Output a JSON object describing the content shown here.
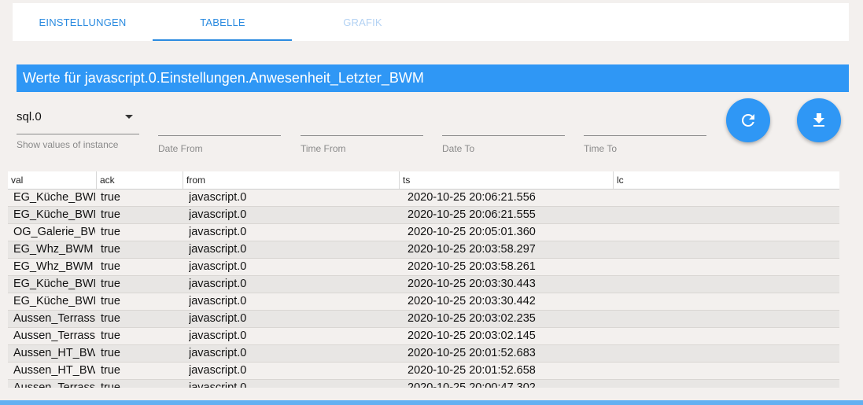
{
  "tabs": [
    {
      "label": "EINSTELLUNGEN"
    },
    {
      "label": "TABELLE"
    },
    {
      "label": "GRAFIK"
    }
  ],
  "title": "Werte für javascript.0.Einstellungen.Anwesenheit_Letzter_BWM",
  "filters": {
    "instance_value": "sql.0",
    "instance_label": "Show values of instance",
    "date_from_label": "Date From",
    "time_from_label": "Time From",
    "date_to_label": "Date To",
    "time_to_label": "Time To"
  },
  "actions": {
    "refresh_icon": "refresh-icon",
    "download_icon": "download-icon",
    "accent": "#2f97f5"
  },
  "table": {
    "columns": [
      "val",
      "ack",
      "from",
      "ts",
      "lc"
    ],
    "rows": [
      {
        "val": "EG_Küche_BWM",
        "ack": "true",
        "from": "javascript.0",
        "ts": "2020-10-25 20:06:21.556"
      },
      {
        "val": "EG_Küche_BWM",
        "ack": "true",
        "from": "javascript.0",
        "ts": "2020-10-25 20:06:21.555"
      },
      {
        "val": "OG_Galerie_BWM",
        "ack": "true",
        "from": "javascript.0",
        "ts": "2020-10-25 20:05:01.360"
      },
      {
        "val": "EG_Whz_BWM",
        "ack": "true",
        "from": "javascript.0",
        "ts": "2020-10-25 20:03:58.297"
      },
      {
        "val": "EG_Whz_BWM",
        "ack": "true",
        "from": "javascript.0",
        "ts": "2020-10-25 20:03:58.261"
      },
      {
        "val": "EG_Küche_BWM",
        "ack": "true",
        "from": "javascript.0",
        "ts": "2020-10-25 20:03:30.443"
      },
      {
        "val": "EG_Küche_BWM",
        "ack": "true",
        "from": "javascript.0",
        "ts": "2020-10-25 20:03:30.442"
      },
      {
        "val": "Aussen_Terrasse",
        "ack": "true",
        "from": "javascript.0",
        "ts": "2020-10-25 20:03:02.235"
      },
      {
        "val": "Aussen_Terrasse",
        "ack": "true",
        "from": "javascript.0",
        "ts": "2020-10-25 20:03:02.145"
      },
      {
        "val": "Aussen_HT_BWM",
        "ack": "true",
        "from": "javascript.0",
        "ts": "2020-10-25 20:01:52.683"
      },
      {
        "val": "Aussen_HT_BWM",
        "ack": "true",
        "from": "javascript.0",
        "ts": "2020-10-25 20:01:52.658"
      },
      {
        "val": "Aussen_Terrasse",
        "ack": "true",
        "from": "javascript.0",
        "ts": "2020-10-25 20:00:47.302"
      }
    ]
  }
}
